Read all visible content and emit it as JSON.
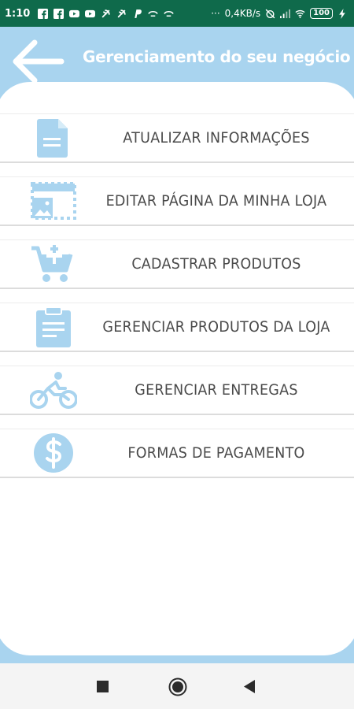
{
  "status_bar": {
    "time": "1:10",
    "network_speed": "0,4KB/s",
    "battery": "100"
  },
  "header": {
    "title": "Gerenciamento do seu negócio",
    "back_icon": "arrow-left-icon"
  },
  "menu": {
    "items": [
      {
        "label": "ATUALIZAR INFORMAÇÕES",
        "icon": "document-icon"
      },
      {
        "label": "EDITAR PÁGINA DA MINHA LOJA",
        "icon": "image-edit-icon"
      },
      {
        "label": "CADASTRAR PRODUTOS",
        "icon": "cart-add-icon"
      },
      {
        "label": "GERENCIAR PRODUTOS DA LOJA",
        "icon": "clipboard-icon"
      },
      {
        "label": "GERENCIAR ENTREGAS",
        "icon": "bicycle-icon"
      },
      {
        "label": "FORMAS DE PAGAMENTO",
        "icon": "dollar-icon"
      }
    ]
  },
  "nav_bar": {
    "recents_icon": "square-icon",
    "home_icon": "circle-icon",
    "back_icon": "triangle-back-icon"
  },
  "colors": {
    "accent": "#a9d4ef",
    "status_bar": "#0f6a4b",
    "text": "#4a4a4a"
  }
}
